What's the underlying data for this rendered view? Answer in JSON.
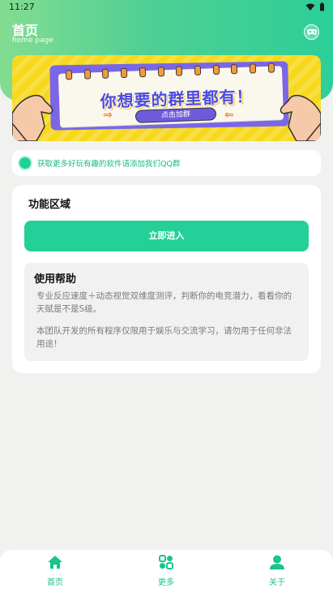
{
  "status": {
    "time": "11:27"
  },
  "header": {
    "title": "首页",
    "subtitle": "home page",
    "action_icon": "game-controller-icon"
  },
  "banner": {
    "headline": "你想要的群里都有！",
    "button_label": "点击加群",
    "arrow_left": "⇒",
    "arrow_right": "⇐"
  },
  "notice": {
    "text": "获取更多好玩有趣的软件请添加我们QQ群"
  },
  "card": {
    "title": "功能区域",
    "enter_label": "立即进入",
    "help": {
      "title": "使用帮助",
      "paragraph1": "专业反应速度＋动态视觉双维度测评，判断你的电竞潜力，看看你的天赋是不是S级。",
      "paragraph2": "本团队开发的所有程序仅限用于娱乐与交流学习，请勿用于任何非法用途！"
    }
  },
  "nav": {
    "items": [
      {
        "label": "首页",
        "icon": "home-icon"
      },
      {
        "label": "更多",
        "icon": "grid-icon"
      },
      {
        "label": "关于",
        "icon": "user-icon"
      }
    ]
  },
  "colors": {
    "accent": "#25cf98",
    "header_start": "#83dd91",
    "header_end": "#2ccf98",
    "notice_text": "#1bb886"
  }
}
